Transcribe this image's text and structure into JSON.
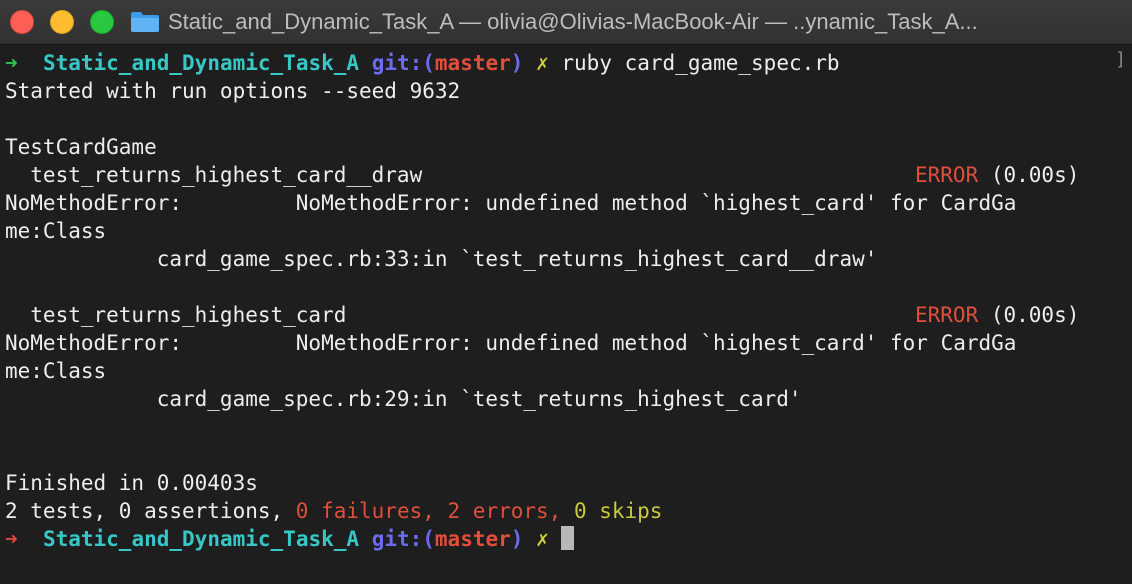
{
  "window": {
    "title": "Static_and_Dynamic_Task_A — olivia@Olivias-MacBook-Air — ..ynamic_Task_A..."
  },
  "prompt": {
    "arrow": "➜",
    "dir": "Static_and_Dynamic_Task_A",
    "git_label": "git:(",
    "branch": "master",
    "git_close": ")",
    "dirty": "✗",
    "command": "ruby card_game_spec.rb"
  },
  "output": {
    "run_options": "Started with run options --seed 9632",
    "suite": "TestCardGame",
    "tests": [
      {
        "name": "  test_returns_highest_card__draw",
        "status": "ERROR",
        "time": " (0.00s)",
        "error_line1": "NoMethodError:         NoMethodError: undefined method `highest_card' for CardGa",
        "error_line2": "me:Class",
        "trace": "            card_game_spec.rb:33:in `test_returns_highest_card__draw'"
      },
      {
        "name": "  test_returns_highest_card",
        "status": "ERROR",
        "time": " (0.00s)",
        "error_line1": "NoMethodError:         NoMethodError: undefined method `highest_card' for CardGa",
        "error_line2": "me:Class",
        "trace": "            card_game_spec.rb:29:in `test_returns_highest_card'"
      }
    ],
    "finished": "Finished in 0.00403s",
    "summary_prefix": "2 tests, 0 assertions, ",
    "summary_failures": "0 failures, 2 errors, ",
    "summary_skips": "0 skips"
  },
  "colors": {
    "background": "#1e1e1e",
    "prompt_dir": "#38c7c7",
    "git": "#6b6bf0",
    "branch": "#e04e3c",
    "error": "#e04e3c",
    "skips": "#c9c93f"
  }
}
